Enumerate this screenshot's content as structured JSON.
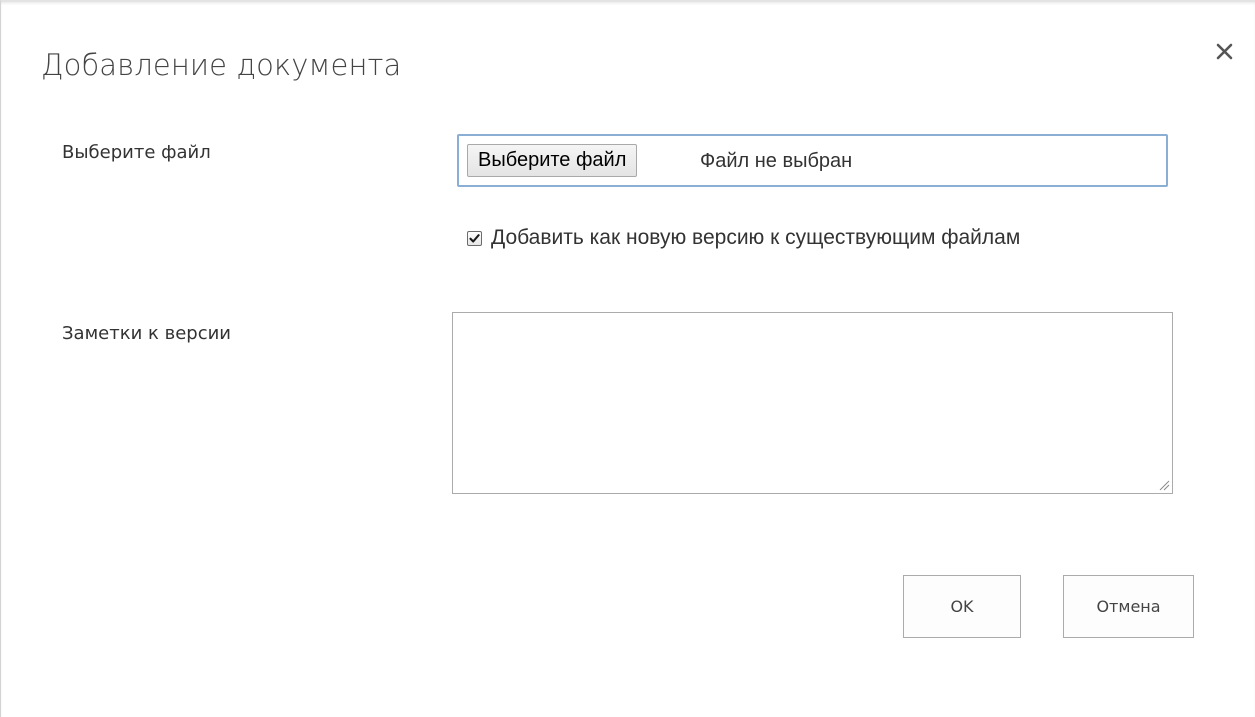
{
  "dialog": {
    "title": "Добавление документа",
    "close_icon": "close-icon"
  },
  "file": {
    "label": "Выберите файл",
    "button_label": "Выберите файл",
    "status": "Файл не выбран"
  },
  "version": {
    "checkbox_checked": true,
    "checkbox_label": "Добавить как новую версию к существующим файлам"
  },
  "notes": {
    "label": "Заметки к версии",
    "value": ""
  },
  "actions": {
    "ok_label": "OK",
    "cancel_label": "Отмена"
  },
  "colors": {
    "focus_border": "#8aaed4",
    "title_text": "#444444"
  }
}
